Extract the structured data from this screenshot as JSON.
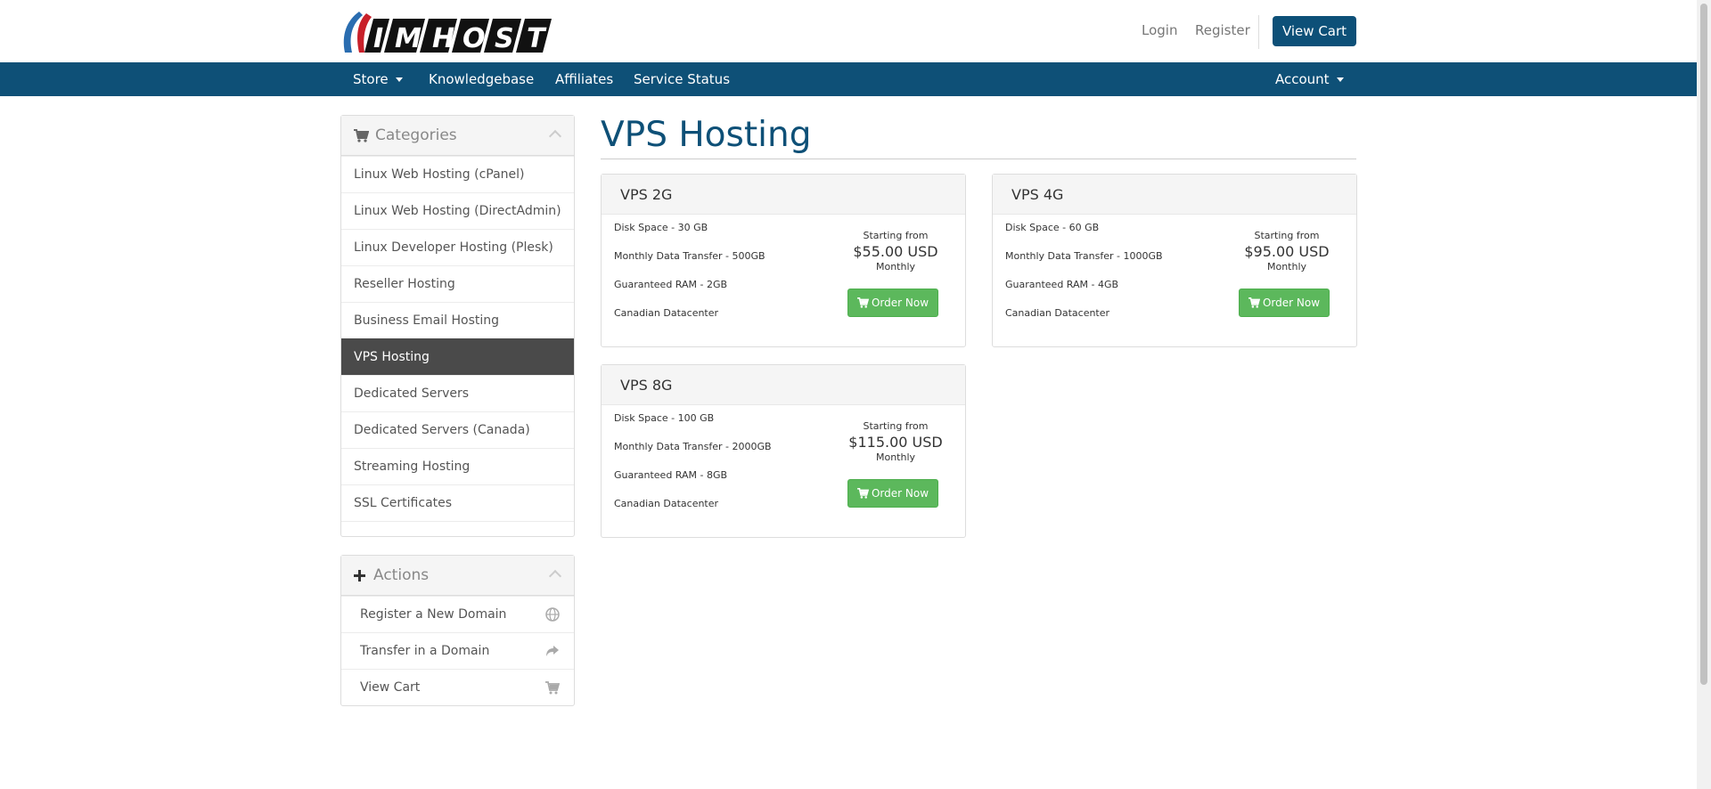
{
  "brand": {
    "logo_text": "IMHOST"
  },
  "header": {
    "login": "Login",
    "register": "Register",
    "view_cart": "View Cart"
  },
  "nav": {
    "store": "Store",
    "knowledgebase": "Knowledgebase",
    "affiliates": "Affiliates",
    "service_status": "Service Status",
    "account": "Account"
  },
  "sidebar": {
    "categories_title": "Categories",
    "categories": [
      "Linux Web Hosting (cPanel)",
      "Linux Web Hosting (DirectAdmin)",
      "Linux Developer Hosting (Plesk)",
      "Reseller Hosting",
      "Business Email Hosting",
      "VPS Hosting",
      "Dedicated Servers",
      "Dedicated Servers (Canada)",
      "Streaming Hosting",
      "SSL Certificates"
    ],
    "active_category": "VPS Hosting",
    "actions_title": "Actions",
    "actions": [
      {
        "label": "Register a New Domain",
        "icon": "globe-icon"
      },
      {
        "label": "Transfer in a Domain",
        "icon": "share-arrow-icon"
      },
      {
        "label": "View Cart",
        "icon": "cart-icon"
      }
    ]
  },
  "main": {
    "title": "VPS Hosting",
    "products": [
      {
        "name": "VPS 2G",
        "features": [
          "Disk Space - 30 GB",
          "Monthly Data Transfer - 500GB",
          "Guaranteed RAM - 2GB",
          "Canadian Datacenter"
        ],
        "starting_from": "Starting from",
        "price": "$55.00 USD",
        "cycle": "Monthly",
        "order_label": "Order Now"
      },
      {
        "name": "VPS 4G",
        "features": [
          "Disk Space - 60 GB",
          "Monthly Data Transfer - 1000GB",
          "Guaranteed RAM - 4GB",
          "Canadian Datacenter"
        ],
        "starting_from": "Starting from",
        "price": "$95.00 USD",
        "cycle": "Monthly",
        "order_label": "Order Now"
      },
      {
        "name": "VPS 8G",
        "features": [
          "Disk Space - 100 GB",
          "Monthly Data Transfer - 2000GB",
          "Guaranteed RAM - 8GB",
          "Canadian Datacenter"
        ],
        "starting_from": "Starting from",
        "price": "$115.00 USD",
        "cycle": "Monthly",
        "order_label": "Order Now"
      }
    ]
  },
  "colors": {
    "brand_blue": "#0e5077",
    "order_green": "#5cb85c",
    "active_item": "#4a4a4a"
  }
}
